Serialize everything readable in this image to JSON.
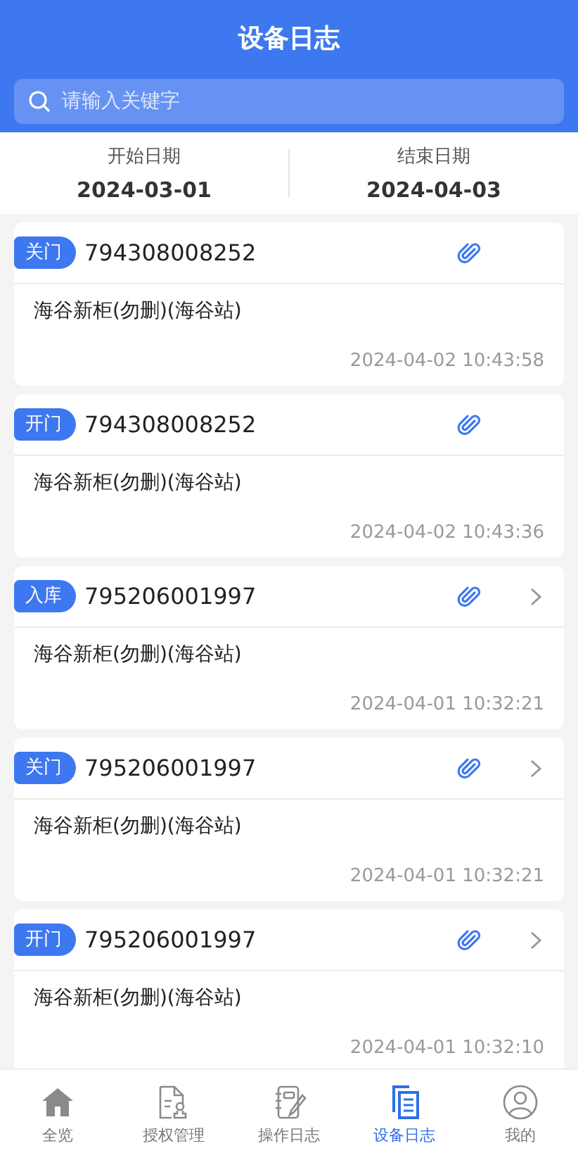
{
  "header": {
    "title": "设备日志"
  },
  "search": {
    "placeholder": "请输入关键字"
  },
  "date_range": [
    {
      "label": "开始日期",
      "value": "2024-03-01"
    },
    {
      "label": "结束日期",
      "value": "2024-04-03"
    }
  ],
  "logs": [
    {
      "action": "关门",
      "device_no": "794308008252",
      "location": "海谷新柜(勿删)(海谷站)",
      "time": "2024-04-02 10:43:58",
      "has_chevron": false
    },
    {
      "action": "开门",
      "device_no": "794308008252",
      "location": "海谷新柜(勿删)(海谷站)",
      "time": "2024-04-02 10:43:36",
      "has_chevron": false
    },
    {
      "action": "入库",
      "device_no": "795206001997",
      "location": "海谷新柜(勿删)(海谷站)",
      "time": "2024-04-01 10:32:21",
      "has_chevron": true
    },
    {
      "action": "关门",
      "device_no": "795206001997",
      "location": "海谷新柜(勿删)(海谷站)",
      "time": "2024-04-01 10:32:21",
      "has_chevron": true
    },
    {
      "action": "开门",
      "device_no": "795206001997",
      "location": "海谷新柜(勿删)(海谷站)",
      "time": "2024-04-01 10:32:10",
      "has_chevron": true
    }
  ],
  "tab_bar": [
    {
      "kind": "home",
      "label": "全览",
      "selected": false
    },
    {
      "kind": "authorize",
      "label": "授权管理",
      "selected": false
    },
    {
      "kind": "notebook",
      "label": "操作日志",
      "selected": false
    },
    {
      "kind": "documents",
      "label": "设备日志",
      "selected": true
    },
    {
      "kind": "profile",
      "label": "我的",
      "selected": false
    }
  ]
}
